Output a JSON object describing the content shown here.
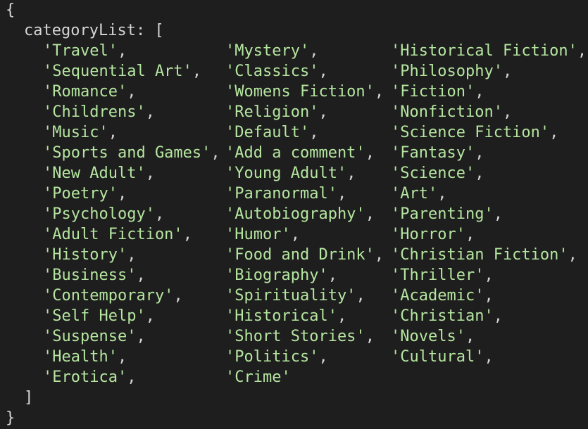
{
  "open_brace": "{",
  "close_brace": "}",
  "key_name": "categoryList",
  "key_colon": ": [",
  "close_bracket": "]",
  "string_color": "#b5e6a0",
  "punct_color": "#d4d4d4",
  "background_color": "#1e1e1e",
  "columns": [
    [
      "'Travel',",
      "'Sequential Art',",
      "'Romance',",
      "'Childrens',",
      "'Music',",
      "'Sports and Games',",
      "'New Adult',",
      "'Poetry',",
      "'Psychology',",
      "'Adult Fiction',",
      "'History',",
      "'Business',",
      "'Contemporary',",
      "'Self Help',",
      "'Suspense',",
      "'Health',",
      "'Erotica',"
    ],
    [
      "'Mystery',",
      "'Classics',",
      "'Womens Fiction',",
      "'Religion',",
      "'Default',",
      "'Add a comment',",
      "'Young Adult',",
      "'Paranormal',",
      "'Autobiography',",
      "'Humor',",
      "'Food and Drink',",
      "'Biography',",
      "'Spirituality',",
      "'Historical',",
      "'Short Stories',",
      "'Politics',",
      "'Crime'"
    ],
    [
      "'Historical Fiction',",
      "'Philosophy',",
      "'Fiction',",
      "'Nonfiction',",
      "'Science Fiction',",
      "'Fantasy',",
      "'Science',",
      "'Art',",
      "'Parenting',",
      "'Horror',",
      "'Christian Fiction',",
      "'Thriller',",
      "'Academic',",
      "'Christian',",
      "'Novels',",
      "'Cultural',"
    ]
  ]
}
